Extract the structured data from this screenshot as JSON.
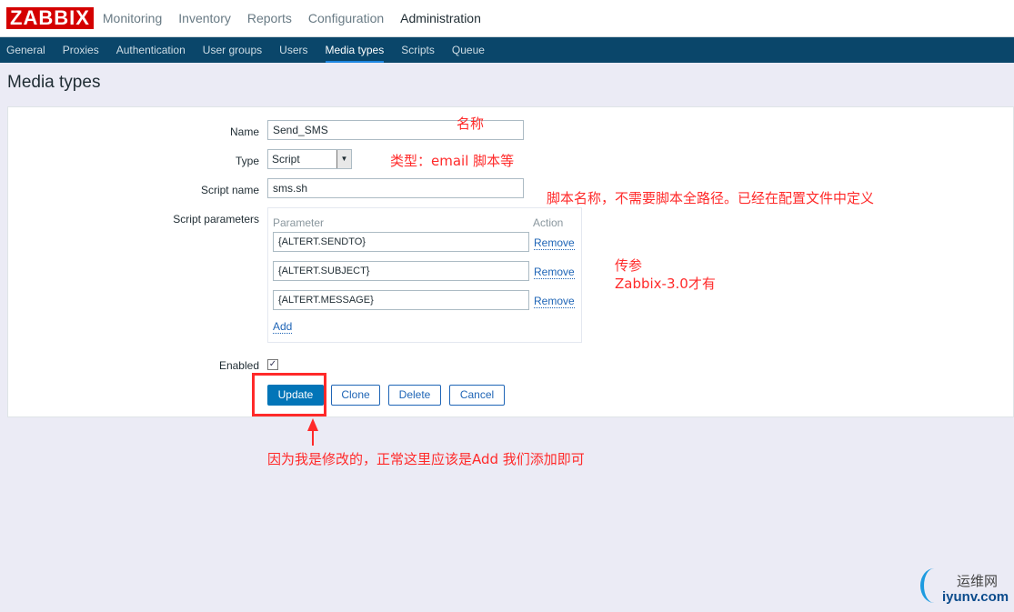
{
  "logo": "ZABBIX",
  "main_nav": [
    "Monitoring",
    "Inventory",
    "Reports",
    "Configuration",
    "Administration"
  ],
  "sub_nav": [
    "General",
    "Proxies",
    "Authentication",
    "User groups",
    "Users",
    "Media types",
    "Scripts",
    "Queue"
  ],
  "page_title": "Media types",
  "form": {
    "name_label": "Name",
    "name_value": "Send_SMS",
    "type_label": "Type",
    "type_value": "Script",
    "script_name_label": "Script name",
    "script_name_value": "sms.sh",
    "params_label": "Script parameters",
    "param_header": "Parameter",
    "action_header": "Action",
    "params": [
      "{ALTERT.SENDTO}",
      "{ALTERT.SUBJECT}",
      "{ALTERT.MESSAGE}"
    ],
    "remove": "Remove",
    "add": "Add",
    "enabled_label": "Enabled",
    "enabled": true
  },
  "buttons": {
    "update": "Update",
    "clone": "Clone",
    "delete": "Delete",
    "cancel": "Cancel"
  },
  "annotations": {
    "name": "名称",
    "type": "类型：email 脚本等",
    "script": "脚本名称，不需要脚本全路径。已经在配置文件中定义",
    "params1": "传参",
    "params2": "Zabbix-3.0才有",
    "update": "因为我是修改的，正常这里应该是Add 我们添加即可"
  },
  "watermark": {
    "cn": "运维网",
    "en": "iyunv.com"
  },
  "colors": {
    "accent": "#0275b8",
    "annotation": "#ff2a2a",
    "header": "#0a466a"
  }
}
